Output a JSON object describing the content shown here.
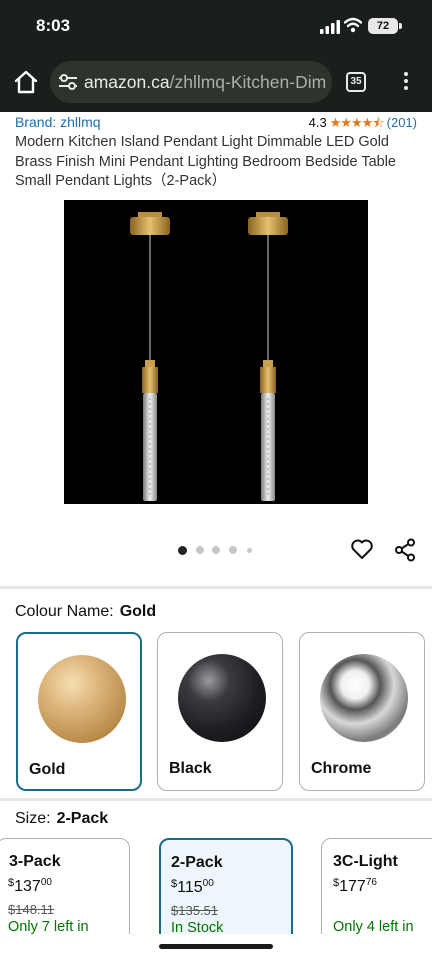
{
  "status_bar": {
    "time": "8:03",
    "battery": "72"
  },
  "browser": {
    "url_host": "amazon.ca",
    "url_path": "/zhllmq-Kitchen-Dim",
    "tab_count": "35"
  },
  "product": {
    "brand": "Brand: zhllmq",
    "rating": "4.3",
    "stars": "★★★★⯪",
    "rating_count": "(201)",
    "title": "Modern Kitchen Island Pendant Light Dimmable LED Gold Brass Finish Mini Pendant Lighting Bedroom Bedside Table Small Pendant Lights（2-Pack）",
    "image_count": 5,
    "active_image_index": 0
  },
  "colour": {
    "label": "Colour Name:",
    "selected": "Gold",
    "options": [
      {
        "name": "Gold",
        "color": "#c8a060"
      },
      {
        "name": "Black",
        "color": "#1e1e22"
      },
      {
        "name": "Chrome",
        "color": "#b8b8b8"
      }
    ]
  },
  "size": {
    "label": "Size:",
    "selected": "2-Pack",
    "options": [
      {
        "name": "3-Pack",
        "currency": "$",
        "price_whole": "137",
        "price_frac": "00",
        "list_price": "$148.11",
        "stock": "Only 7 left in"
      },
      {
        "name": "2-Pack",
        "currency": "$",
        "price_whole": "115",
        "price_frac": "00",
        "list_price": "$135.51",
        "stock": "In Stock"
      },
      {
        "name": "3C-Light",
        "currency": "$",
        "price_whole": "177",
        "price_frac": "76",
        "list_price": "",
        "stock": "Only 4 left in"
      }
    ]
  },
  "colors": {
    "link": "#1f6fa8",
    "star": "#de7921",
    "in_stock": "#007600",
    "selected_border": "#1b6a8a"
  }
}
